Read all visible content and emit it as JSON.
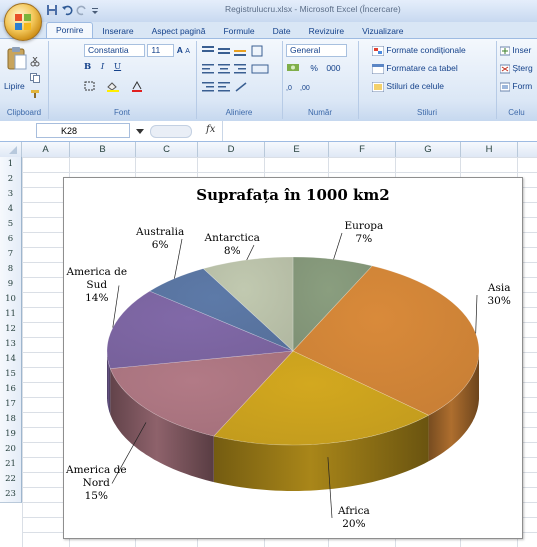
{
  "window": {
    "title": "Registrulucru.xlsx - Microsoft Excel (Încercare)"
  },
  "tabs": [
    {
      "label": "Pornire",
      "active": true
    },
    {
      "label": "Inserare"
    },
    {
      "label": "Aspect pagină"
    },
    {
      "label": "Formule"
    },
    {
      "label": "Date"
    },
    {
      "label": "Revizuire"
    },
    {
      "label": "Vizualizare"
    }
  ],
  "ribbon": {
    "clipboard": {
      "paste_label": "Lipire",
      "group_label": "Clipboard"
    },
    "font": {
      "font_name": "Constantia",
      "font_size": "11",
      "group_label": "Font",
      "bold": "B",
      "italic": "I",
      "underline": "U",
      "grow": "A",
      "shrink": "A"
    },
    "alignment": {
      "group_label": "Aliniere"
    },
    "number": {
      "format": "General",
      "percent": "%",
      "thousands": "000",
      "group_label": "Număr"
    },
    "styles": {
      "conditional": "Formate condiționale",
      "table": "Formatare ca tabel",
      "cell_styles": "Stiluri de celule",
      "group_label": "Stiluri"
    },
    "cells": {
      "insert": "Inser",
      "delete": "Șterg",
      "format": "Form",
      "group_label": "Celu"
    }
  },
  "formula_bar": {
    "name_box": "K28",
    "fx": "fx",
    "value": ""
  },
  "columns": [
    "A",
    "B",
    "C",
    "D",
    "E",
    "F",
    "G",
    "H"
  ],
  "rows": [
    "1",
    "2",
    "3",
    "4",
    "5",
    "6",
    "7",
    "8",
    "9",
    "10",
    "11",
    "12",
    "13",
    "14",
    "15",
    "16",
    "17",
    "18",
    "19",
    "20",
    "21",
    "22",
    "23"
  ],
  "chart_data": {
    "type": "pie",
    "title": "Suprafața în 1000 km2",
    "style": "3d-exploded-none",
    "slices": [
      {
        "name": "Europa",
        "value": 7,
        "label": "7%",
        "color": "#8a9e7f"
      },
      {
        "name": "Asia",
        "value": 30,
        "label": "30%",
        "color": "#d98a3a"
      },
      {
        "name": "Africa",
        "value": 20,
        "label": "20%",
        "color": "#d3a81f"
      },
      {
        "name": "America de Nord",
        "value": 15,
        "label": "15%",
        "color": "#b27a86"
      },
      {
        "name": "America de Sud",
        "value": 14,
        "label": "14%",
        "color": "#8169a8"
      },
      {
        "name": "Australia",
        "value": 6,
        "label": "6%",
        "color": "#5d7aa8"
      },
      {
        "name": "Antarctica",
        "value": 8,
        "label": "8%",
        "color": "#c1c9b0"
      }
    ]
  }
}
